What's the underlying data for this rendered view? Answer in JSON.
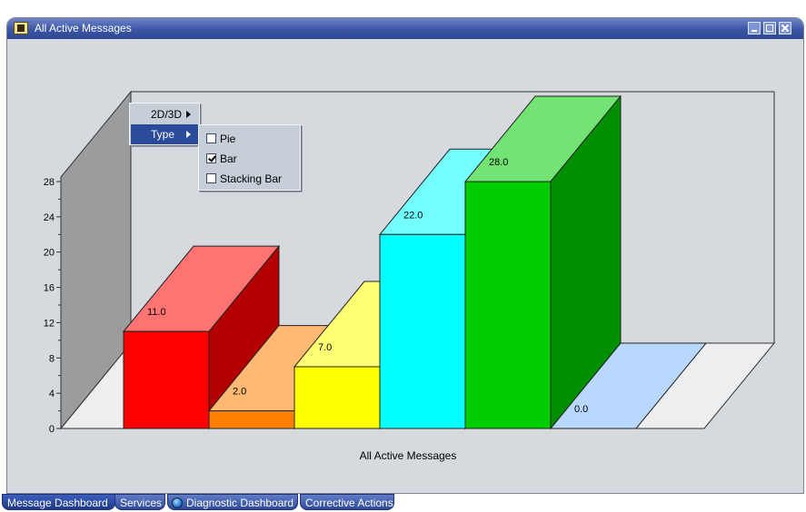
{
  "window": {
    "title": "All Active Messages"
  },
  "chart_data": {
    "type": "bar",
    "projection": "3d",
    "title": "",
    "xlabel": "All Active Messages",
    "ylabel": "",
    "categories": [],
    "values": [
      11.0,
      2.0,
      7.0,
      22.0,
      28.0,
      0.0
    ],
    "data_labels": [
      "11.0",
      "2.0",
      "7.0",
      "22.0",
      "28.0",
      "0.0"
    ],
    "colors": [
      "#ff0000",
      "#ff7f00",
      "#ffff00",
      "#00ffff",
      "#00cc00",
      "#7fb8ff"
    ],
    "yticks": [
      "0",
      "4",
      "8",
      "12",
      "16",
      "20",
      "24",
      "28"
    ],
    "ylim": [
      0,
      28
    ],
    "grid": false,
    "legend": "none"
  },
  "context_menu": {
    "items": [
      {
        "label": "2D/3D",
        "has_submenu": true
      },
      {
        "label": "Type",
        "has_submenu": true
      }
    ],
    "submenu": [
      {
        "label": "Pie",
        "checked": false
      },
      {
        "label": "Bar",
        "checked": true
      },
      {
        "label": "Stacking Bar",
        "checked": false
      }
    ]
  },
  "tabs": [
    {
      "label": "Message Dashboard",
      "active": true
    },
    {
      "label": "Services",
      "active": false
    },
    {
      "label": "Diagnostic Dashboard",
      "active": false,
      "icon": "globe-icon"
    },
    {
      "label": "Corrective Actions",
      "active": false
    }
  ]
}
